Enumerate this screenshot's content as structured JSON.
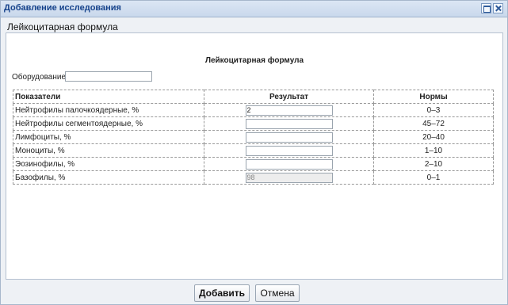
{
  "window": {
    "title": "Добавление исследования"
  },
  "panel": {
    "header": "Лейкоцитарная формула",
    "inner_title": "Лейкоцитарная формула"
  },
  "equipment": {
    "label": "Оборудование:",
    "value": ""
  },
  "table": {
    "headers": {
      "indicator": "Показатели",
      "result": "Результат",
      "norms": "Нормы"
    },
    "rows": [
      {
        "name": "Нейтрофилы палочкоядерные, %",
        "result": "2",
        "norm": "0–3",
        "readonly": false
      },
      {
        "name": "Нейтрофилы сегментоядерные, %",
        "result": "",
        "norm": "45–72",
        "readonly": false
      },
      {
        "name": "Лимфоциты, %",
        "result": "",
        "norm": "20–40",
        "readonly": false
      },
      {
        "name": "Моноциты, %",
        "result": "",
        "norm": "1–10",
        "readonly": false
      },
      {
        "name": "Эозинофилы, %",
        "result": "",
        "norm": "2–10",
        "readonly": false
      },
      {
        "name": "Базофилы, %",
        "result": "98",
        "norm": "0–1",
        "readonly": true
      }
    ]
  },
  "buttons": {
    "add": "Добавить",
    "cancel": "Отмена"
  }
}
